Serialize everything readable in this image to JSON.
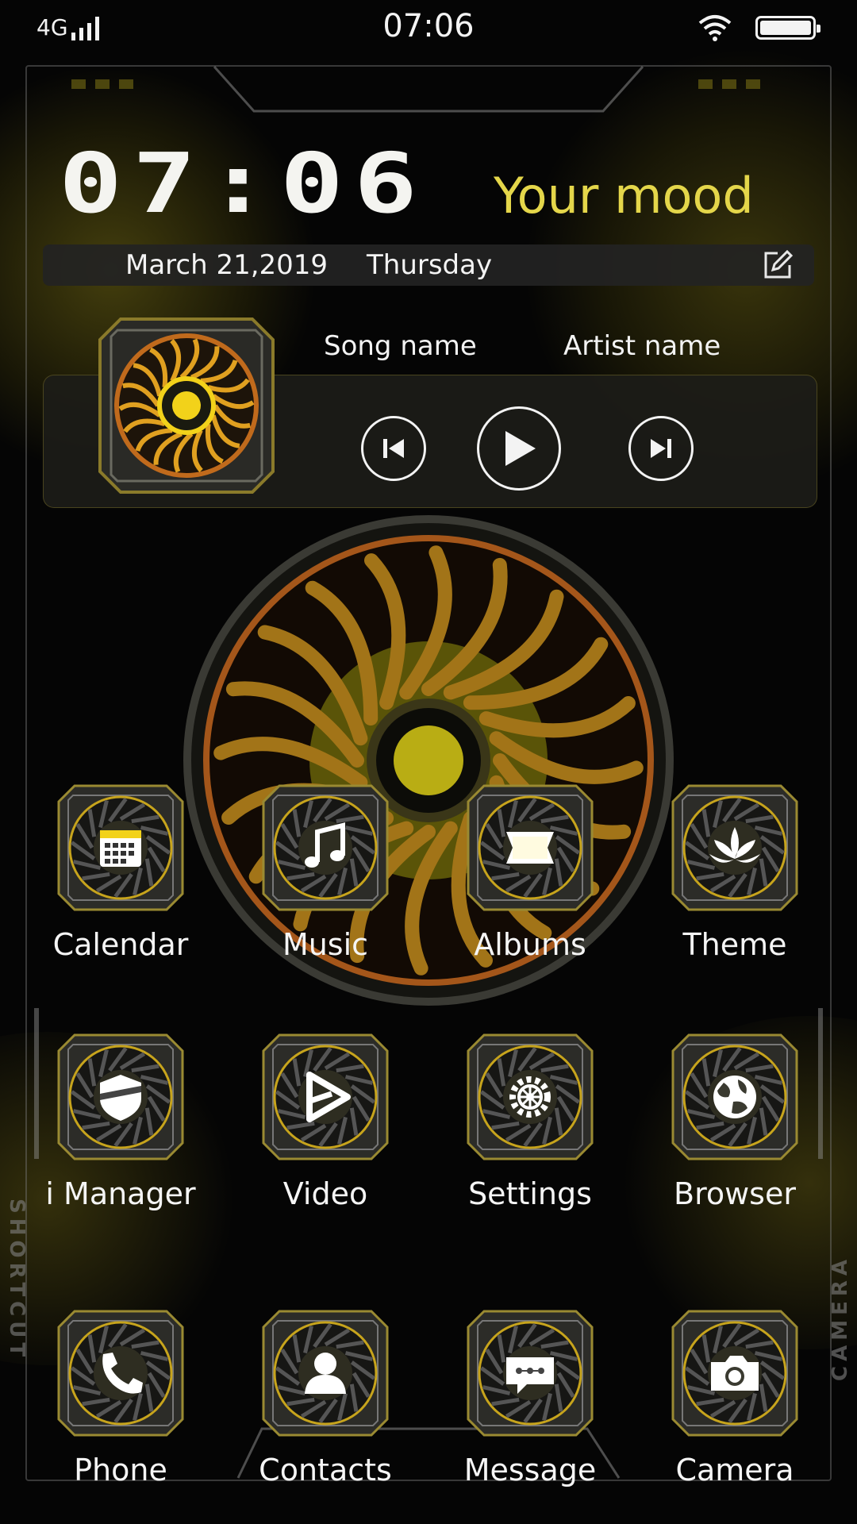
{
  "status_bar": {
    "network": "4G",
    "time": "07:06"
  },
  "clock_widget": {
    "time": "07:06",
    "mood": "Your mood",
    "date": "March 21,2019",
    "weekday": "Thursday"
  },
  "music_widget": {
    "song": "Song name",
    "artist": "Artist name"
  },
  "apps": [
    {
      "label": "Calendar",
      "icon": "calendar-icon"
    },
    {
      "label": "Music",
      "icon": "music-note-icon"
    },
    {
      "label": "Albums",
      "icon": "photo-frame-icon"
    },
    {
      "label": "Theme",
      "icon": "lotus-icon"
    },
    {
      "label": "i Manager",
      "icon": "shield-icon"
    },
    {
      "label": "Video",
      "icon": "play-triangle-icon"
    },
    {
      "label": "Settings",
      "icon": "gear-icon"
    },
    {
      "label": "Browser",
      "icon": "globe-icon"
    },
    {
      "label": "Phone",
      "icon": "phone-handset-icon"
    },
    {
      "label": "Contacts",
      "icon": "person-icon"
    },
    {
      "label": "Message",
      "icon": "chat-bubble-icon"
    },
    {
      "label": "Camera",
      "icon": "camera-icon"
    }
  ],
  "side_labels": {
    "left": "SHORTCUT",
    "right": "CAMERA"
  },
  "colors": {
    "accent": "#e4d64a",
    "gold": "#c9a227",
    "text": "#f3f3f3",
    "background": "#050505"
  }
}
